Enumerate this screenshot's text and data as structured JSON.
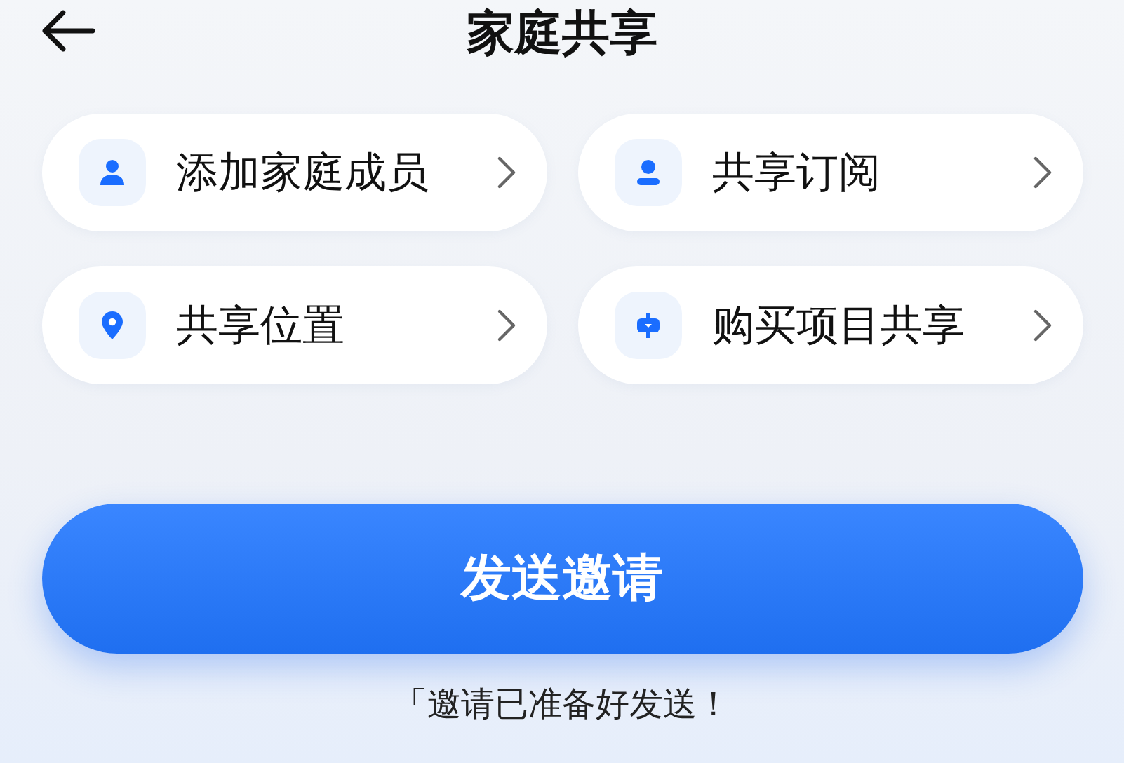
{
  "header": {
    "title": "家庭共享"
  },
  "options": [
    {
      "label": "添加家庭成员",
      "kind": "person"
    },
    {
      "label": "共享订阅",
      "kind": "member"
    },
    {
      "label": "共享位置",
      "kind": "location"
    },
    {
      "label": "购买项目共享",
      "kind": "purchase"
    }
  ],
  "primary_button": {
    "label": "发送邀请"
  },
  "hint": "「邀请已准备好发送！"
}
